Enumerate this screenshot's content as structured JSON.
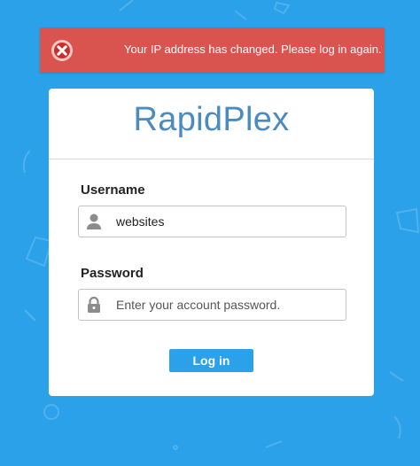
{
  "alert": {
    "message": "Your IP address has changed. Please log in again.",
    "icon": "error-circle-icon",
    "color": "#d9534f"
  },
  "brand": {
    "name": "RapidPlex",
    "color": "#4a8bc1"
  },
  "form": {
    "username": {
      "label": "Username",
      "value": "websites",
      "icon": "user-icon"
    },
    "password": {
      "label": "Password",
      "placeholder": "Enter your account password.",
      "icon": "lock-icon"
    },
    "submit_label": "Log in"
  },
  "colors": {
    "background": "#2aa1e8",
    "button": "#2aa1e8"
  }
}
